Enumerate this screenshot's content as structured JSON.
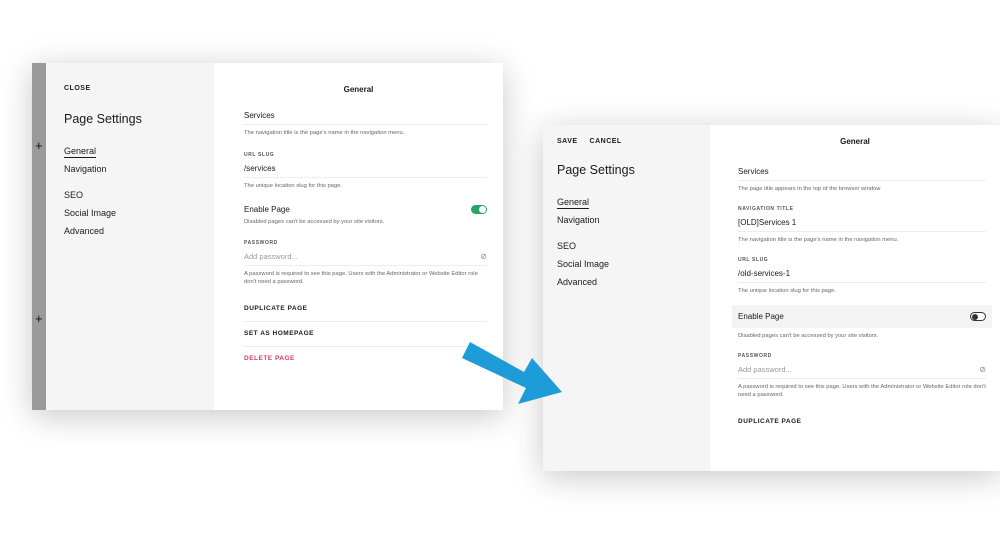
{
  "left_panel": {
    "close_label": "CLOSE",
    "title": "Page Settings",
    "nav": [
      "General",
      "Navigation",
      "SEO",
      "Social Image",
      "Advanced"
    ],
    "header": "General",
    "nav_title_value": "Services",
    "nav_title_help": "The navigation title is the page's name in the navigation menu.",
    "url_slug_label": "URL SLUG",
    "url_slug_value": "/services",
    "url_slug_help": "The unique location slug for this page.",
    "enable_label": "Enable Page",
    "enable_help": "Disabled pages can't be accessed by your site visitors.",
    "password_label": "PASSWORD",
    "password_placeholder": "Add password...",
    "password_help": "A password is required to see this page. Users with the Administrator or Website Editor role don't need a password.",
    "duplicate_label": "DUPLICATE PAGE",
    "homepage_label": "SET AS HOMEPAGE",
    "delete_label": "DELETE PAGE",
    "plus_glyph": "+",
    "enabled": true
  },
  "right_panel": {
    "save_label": "SAVE",
    "cancel_label": "CANCEL",
    "title": "Page Settings",
    "nav": [
      "General",
      "Navigation",
      "SEO",
      "Social Image",
      "Advanced"
    ],
    "header": "General",
    "page_title_value": "Services",
    "page_title_help": "The page title appears in the top of the browser window",
    "nav_title_label": "NAVIGATION TITLE",
    "nav_title_value": "[OLD]Services 1",
    "nav_title_help": "The navigation title is the page's name in the navigation menu.",
    "url_slug_label": "URL SLUG",
    "url_slug_value": "/old-services-1",
    "url_slug_help": "The unique location slug for this page.",
    "enable_label": "Enable Page",
    "enable_help": "Disabled pages can't be accessed by your site visitors.",
    "password_label": "PASSWORD",
    "password_placeholder": "Add password...",
    "password_help": "A password is required to see this page. Users with the Administrator or Website Editor role don't need a password.",
    "duplicate_label": "DUPLICATE PAGE",
    "enabled": false
  },
  "colors": {
    "toggle_on": "#2aa36a",
    "delete_text": "#d0405a",
    "arrow": "#1d9cd8",
    "sidebar_bg": "#f5f5f5"
  }
}
